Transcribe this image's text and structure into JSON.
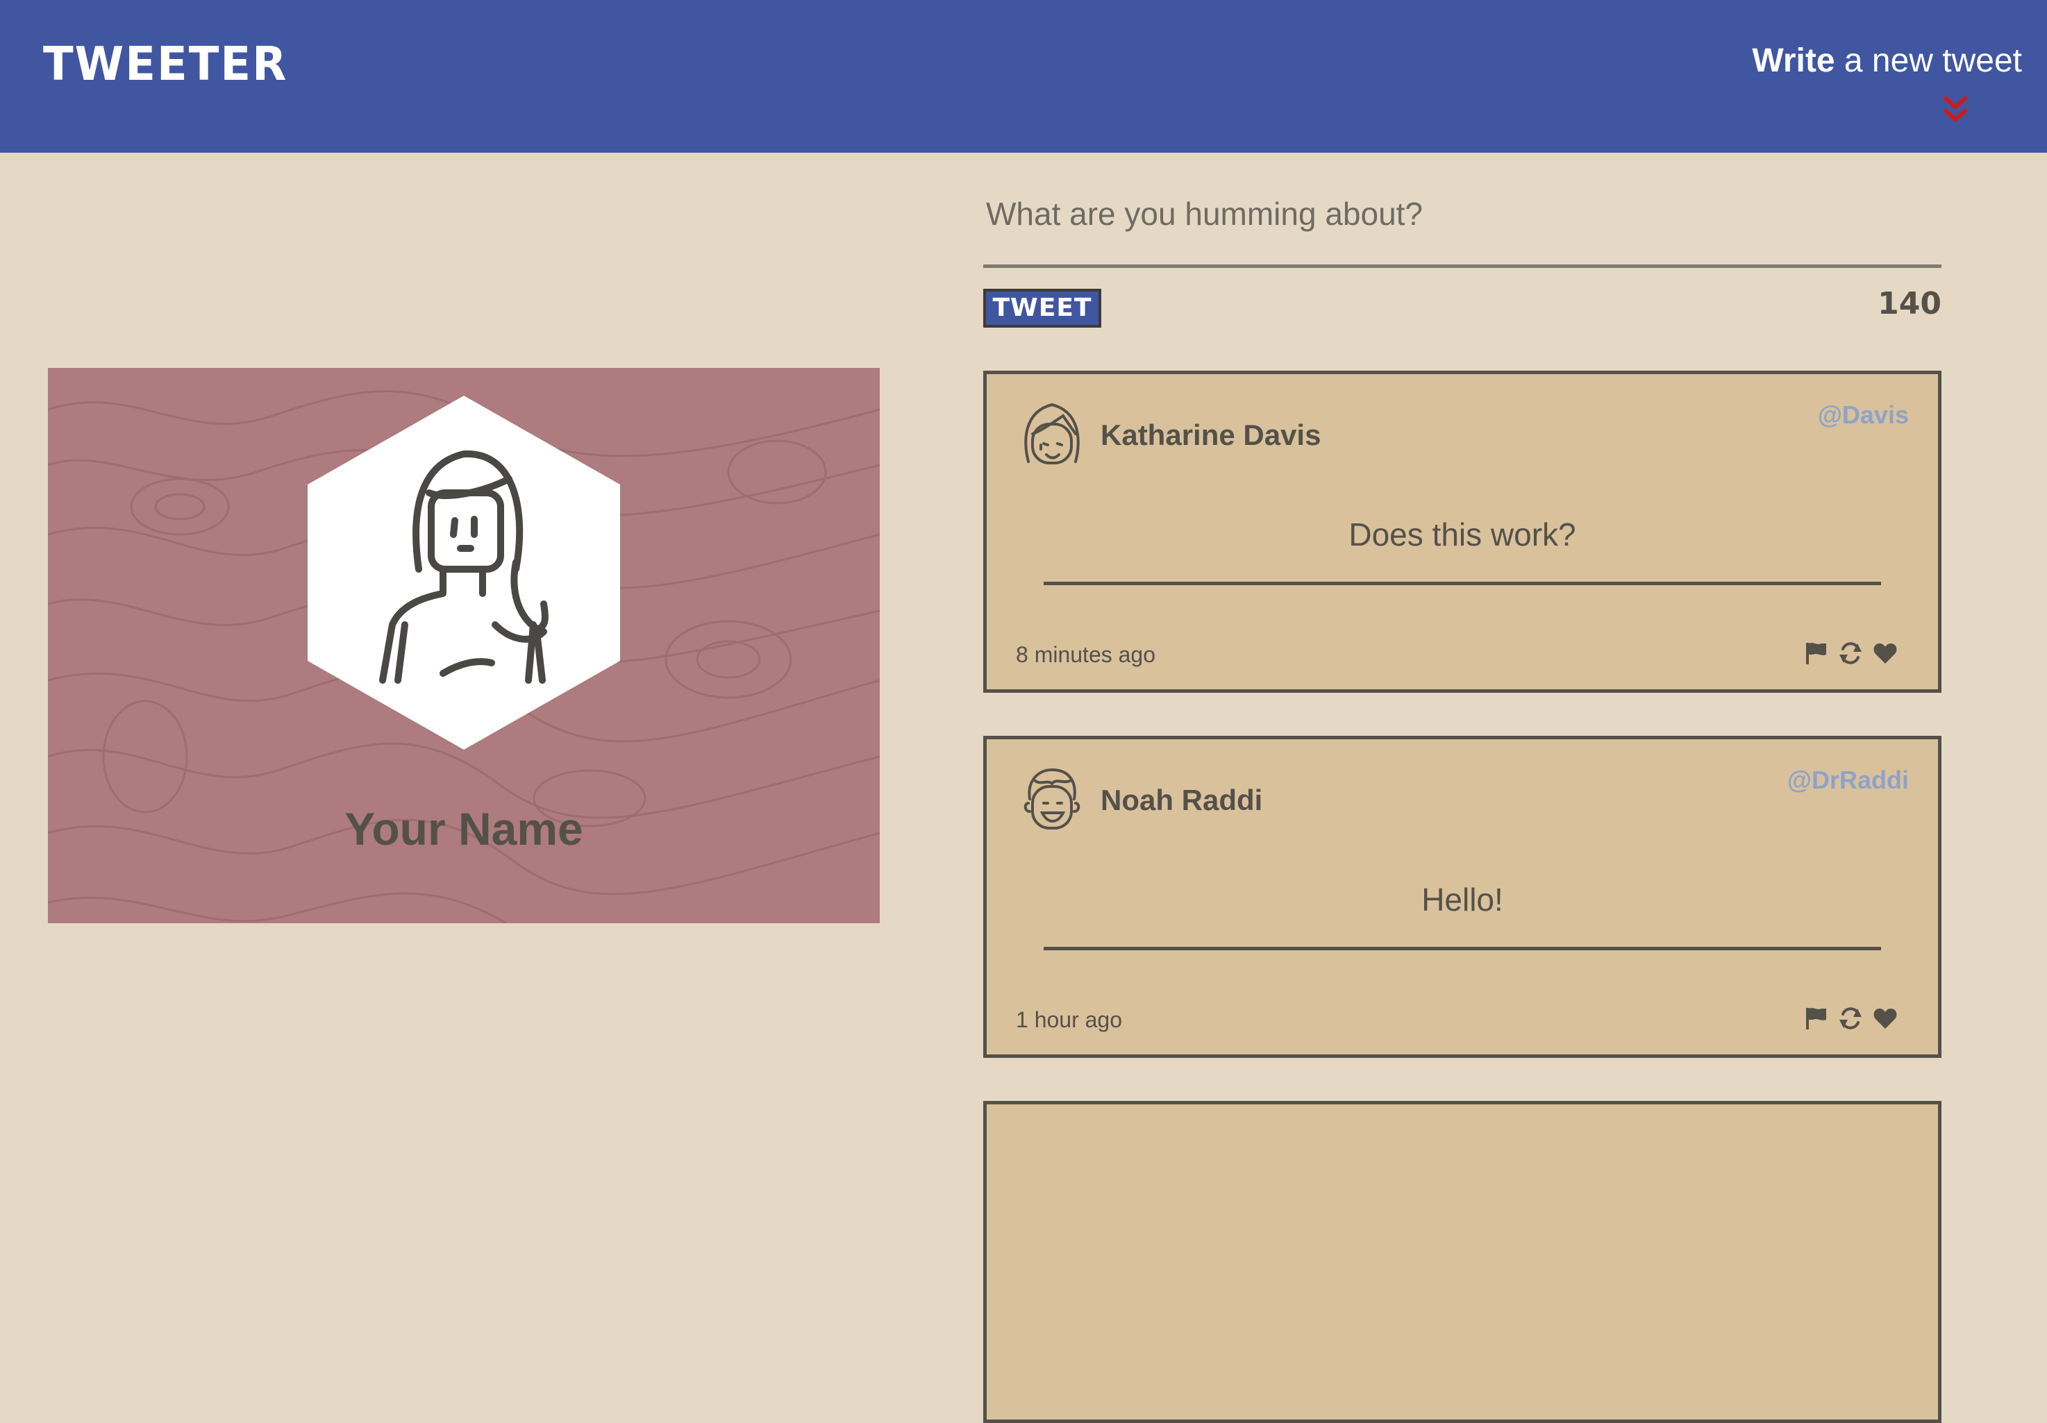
{
  "nav": {
    "brand": "TWEETER",
    "compose_strong": "Write",
    "compose_rest": " a new tweet",
    "chevron_icon": "double-chevron-down-icon",
    "chevron_color": "#cc1b1b"
  },
  "profile": {
    "name": "Your Name",
    "avatar_icon": "person-avatar-icon"
  },
  "composer": {
    "placeholder": "What are you humming about?",
    "button_label": "TWEET",
    "counter": "140"
  },
  "tweets": [
    {
      "name": "Katharine Davis",
      "handle": "@Davis",
      "content": "Does this work?",
      "time": "8 minutes ago",
      "avatar_icon": "woman-avatar-icon"
    },
    {
      "name": "Noah Raddi",
      "handle": "@DrRaddi",
      "content": "Hello!",
      "time": "1 hour ago",
      "avatar_icon": "man-avatar-icon"
    }
  ],
  "actions": [
    "flag-icon",
    "retweet-icon",
    "heart-icon"
  ],
  "colors": {
    "nav": "#4056a1",
    "page": "#e5d9c5",
    "card": "#d9c19c",
    "profile": "#ae7b7e",
    "handle": "#8fa3c6",
    "text": "#545149"
  }
}
